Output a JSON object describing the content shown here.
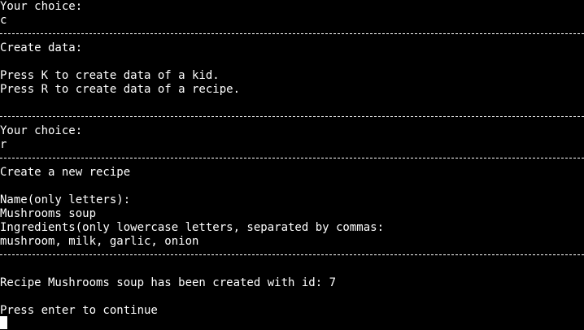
{
  "prompt1": {
    "label": "Your choice:",
    "input": "c"
  },
  "create_data": {
    "title": "Create data:",
    "option_k": "Press K to create data of a kid.",
    "option_r": "Press R to create data of a recipe."
  },
  "prompt2": {
    "label": "Your choice:",
    "input": "r"
  },
  "new_recipe": {
    "title": "Create a new recipe",
    "name_label": "Name(only letters):",
    "name_value": "Mushrooms soup",
    "ingredients_label": "Ingredients(only lowercase letters, separated by commas:",
    "ingredients_value": "mushroom, milk, garlic, onion"
  },
  "result": {
    "message": "Recipe Mushrooms soup has been created with id: 7",
    "continue": "Press enter to continue"
  },
  "colors": {
    "background": "#000000",
    "text": "#ffffff"
  }
}
